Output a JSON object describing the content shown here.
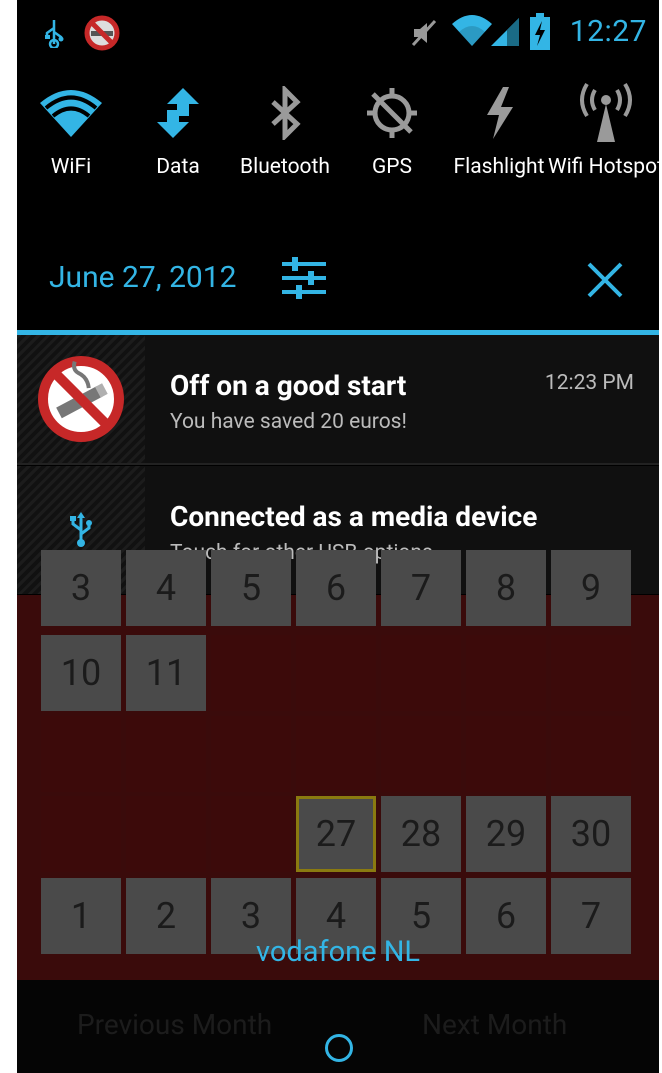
{
  "status_bar": {
    "time": "12:27",
    "left_icons": [
      "usb-icon",
      "no-smoking-app-icon"
    ],
    "right_icons": [
      "mute-icon",
      "wifi-signal-icon",
      "cell-signal-icon",
      "battery-charging-icon"
    ]
  },
  "quick_settings": [
    {
      "label": "WiFi",
      "icon": "wifi-icon",
      "active": true
    },
    {
      "label": "Data",
      "icon": "data-icon",
      "active": true
    },
    {
      "label": "Bluetooth",
      "icon": "bluetooth-icon",
      "active": false
    },
    {
      "label": "GPS",
      "icon": "gps-icon",
      "active": false
    },
    {
      "label": "Flashlight",
      "icon": "flashlight-icon",
      "active": false
    },
    {
      "label": "Wifi Hotspot",
      "icon": "hotspot-icon",
      "active": false
    }
  ],
  "header": {
    "date": "June 27, 2012"
  },
  "notifications": [
    {
      "title": "Off on a good start",
      "subtitle": "You have saved 20 euros!",
      "time": "12:23 PM",
      "icon": "no-smoking-icon"
    },
    {
      "title": "Connected as a media device",
      "subtitle": "Touch for other USB options",
      "time": "",
      "icon": "usb-icon"
    }
  ],
  "calendar": {
    "row_top": [
      "3",
      "4",
      "5",
      "6",
      "7",
      "8",
      "9"
    ],
    "row1": [
      "10",
      "11",
      "",
      "",
      "",
      "",
      ""
    ],
    "row4": [
      "",
      "",
      "",
      "27",
      "28",
      "29",
      "30"
    ],
    "row5": [
      "1",
      "2",
      "3",
      "4",
      "5",
      "6",
      "7"
    ],
    "prev_month": "Previous Month",
    "next_month": "Next Month"
  },
  "carrier": "vodafone NL",
  "colors": {
    "accent": "#33b5e5",
    "background": "#000000"
  }
}
